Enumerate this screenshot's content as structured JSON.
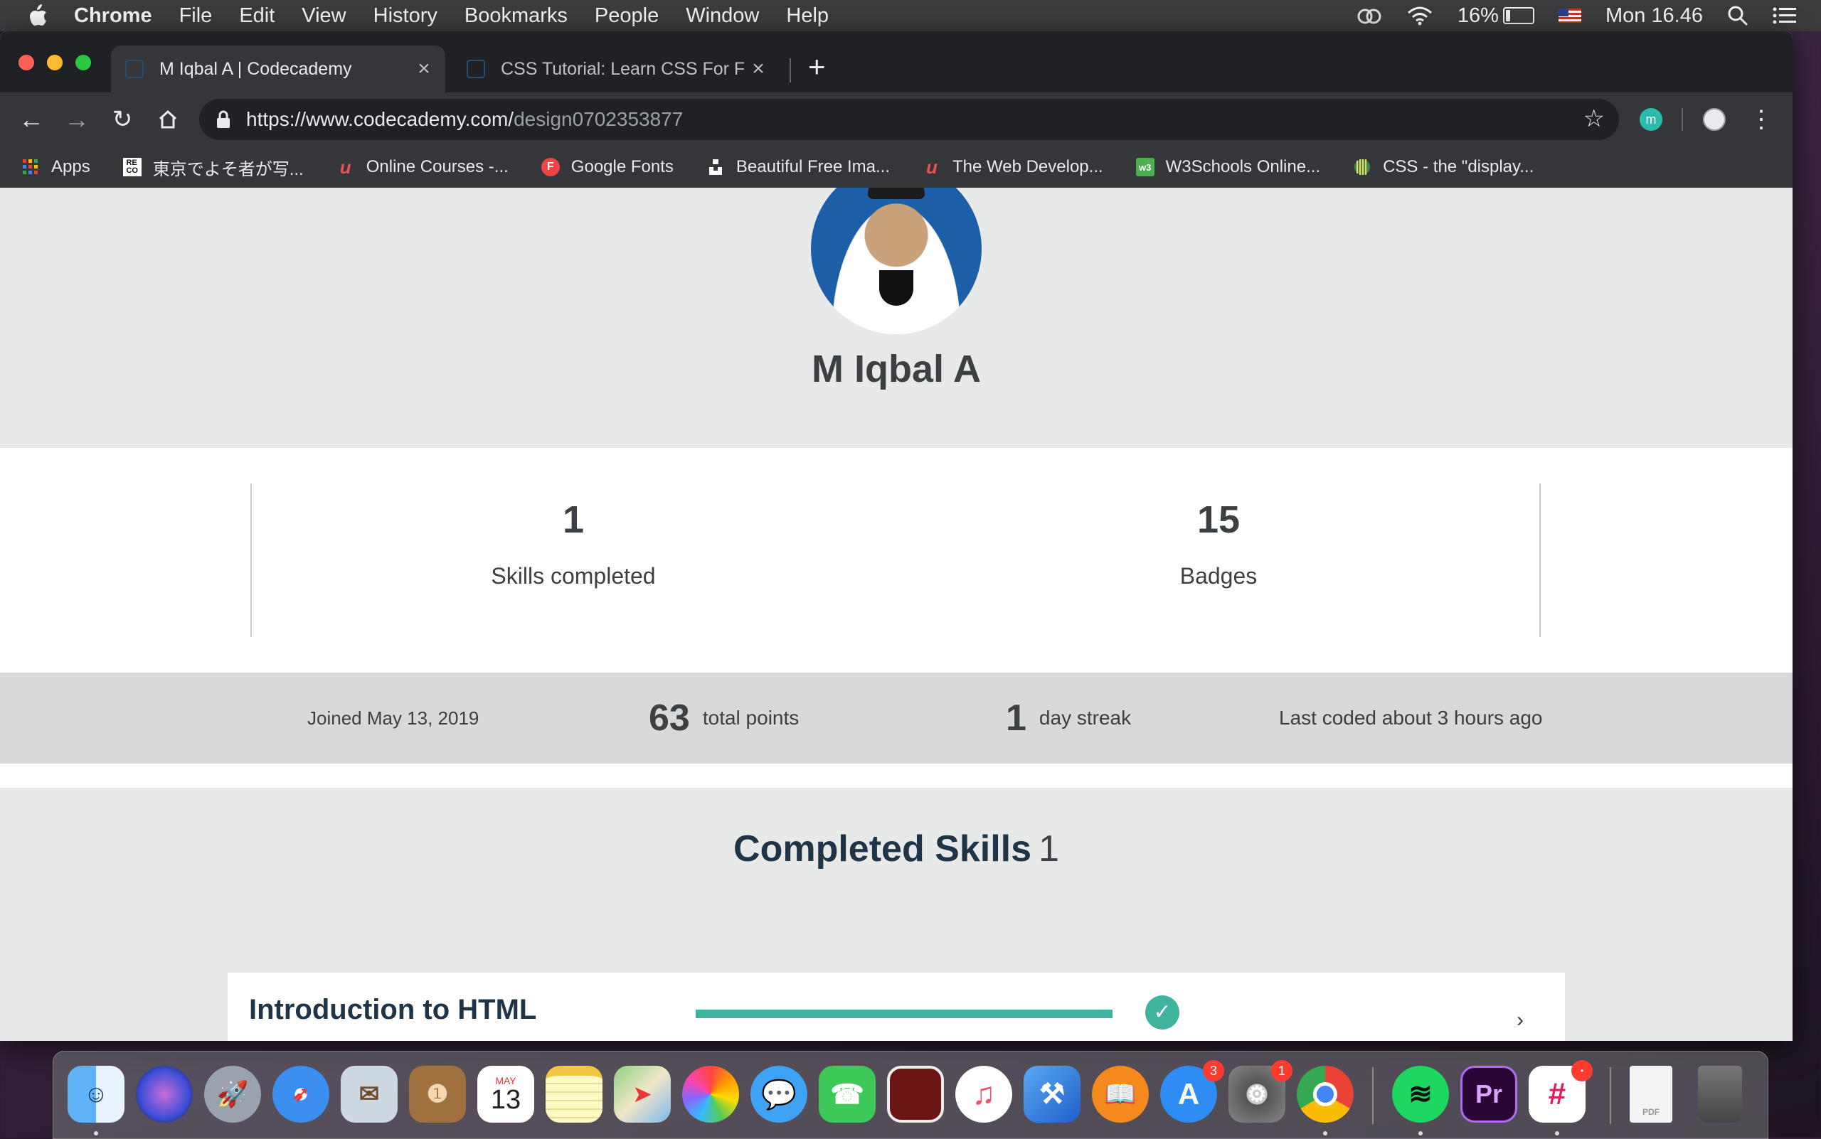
{
  "menubar": {
    "app": "Chrome",
    "items": [
      "File",
      "Edit",
      "View",
      "History",
      "Bookmarks",
      "People",
      "Window",
      "Help"
    ],
    "battery": "16%",
    "battery_level": 0.16,
    "clock": "Mon 16.46"
  },
  "browser": {
    "tabs": [
      {
        "title": "M Iqbal A | Codecademy",
        "active": true
      },
      {
        "title": "CSS Tutorial: Learn CSS For Free",
        "active": false
      }
    ],
    "url_host": "https://www.codecademy.com/",
    "url_path": "design0702353877",
    "bookmarks": [
      {
        "label": "Apps",
        "icon": "apps-grid-icon"
      },
      {
        "label": "東京でよそ者が写...",
        "icon": "reco-icon"
      },
      {
        "label": "Online Courses -...",
        "icon": "udemy-icon"
      },
      {
        "label": "Google Fonts",
        "icon": "google-fonts-icon"
      },
      {
        "label": "Beautiful Free Ima...",
        "icon": "unsplash-icon"
      },
      {
        "label": "The Web Develop...",
        "icon": "udemy-icon"
      },
      {
        "label": "W3Schools Online...",
        "icon": "w3schools-icon"
      },
      {
        "label": "CSS - the \"display...",
        "icon": "globe-icon"
      }
    ],
    "profile_initial": "m"
  },
  "profile": {
    "name": "M Iqbal A",
    "stats": [
      {
        "value": "1",
        "label": "Skills completed"
      },
      {
        "value": "15",
        "label": "Badges"
      }
    ],
    "joined": "Joined May 13, 2019",
    "points_value": "63",
    "points_label": "total points",
    "streak_value": "1",
    "streak_label": "day streak",
    "last_coded": "Last coded about 3 hours ago"
  },
  "completed_skills": {
    "title": "Completed Skills",
    "count": "1",
    "items": [
      {
        "name": "Introduction to HTML",
        "progress": 1.0,
        "completed": true
      }
    ]
  },
  "dock": {
    "calendar_month": "MAY",
    "calendar_day": "13",
    "badges": {
      "app_store": "3",
      "system_preferences": "1"
    },
    "premiere_label": "Pr"
  },
  "colors": {
    "accent": "#3fb39d",
    "heading": "#1f3447",
    "page_bg": "#e8eaea",
    "strip_bg": "#d7d9da"
  }
}
